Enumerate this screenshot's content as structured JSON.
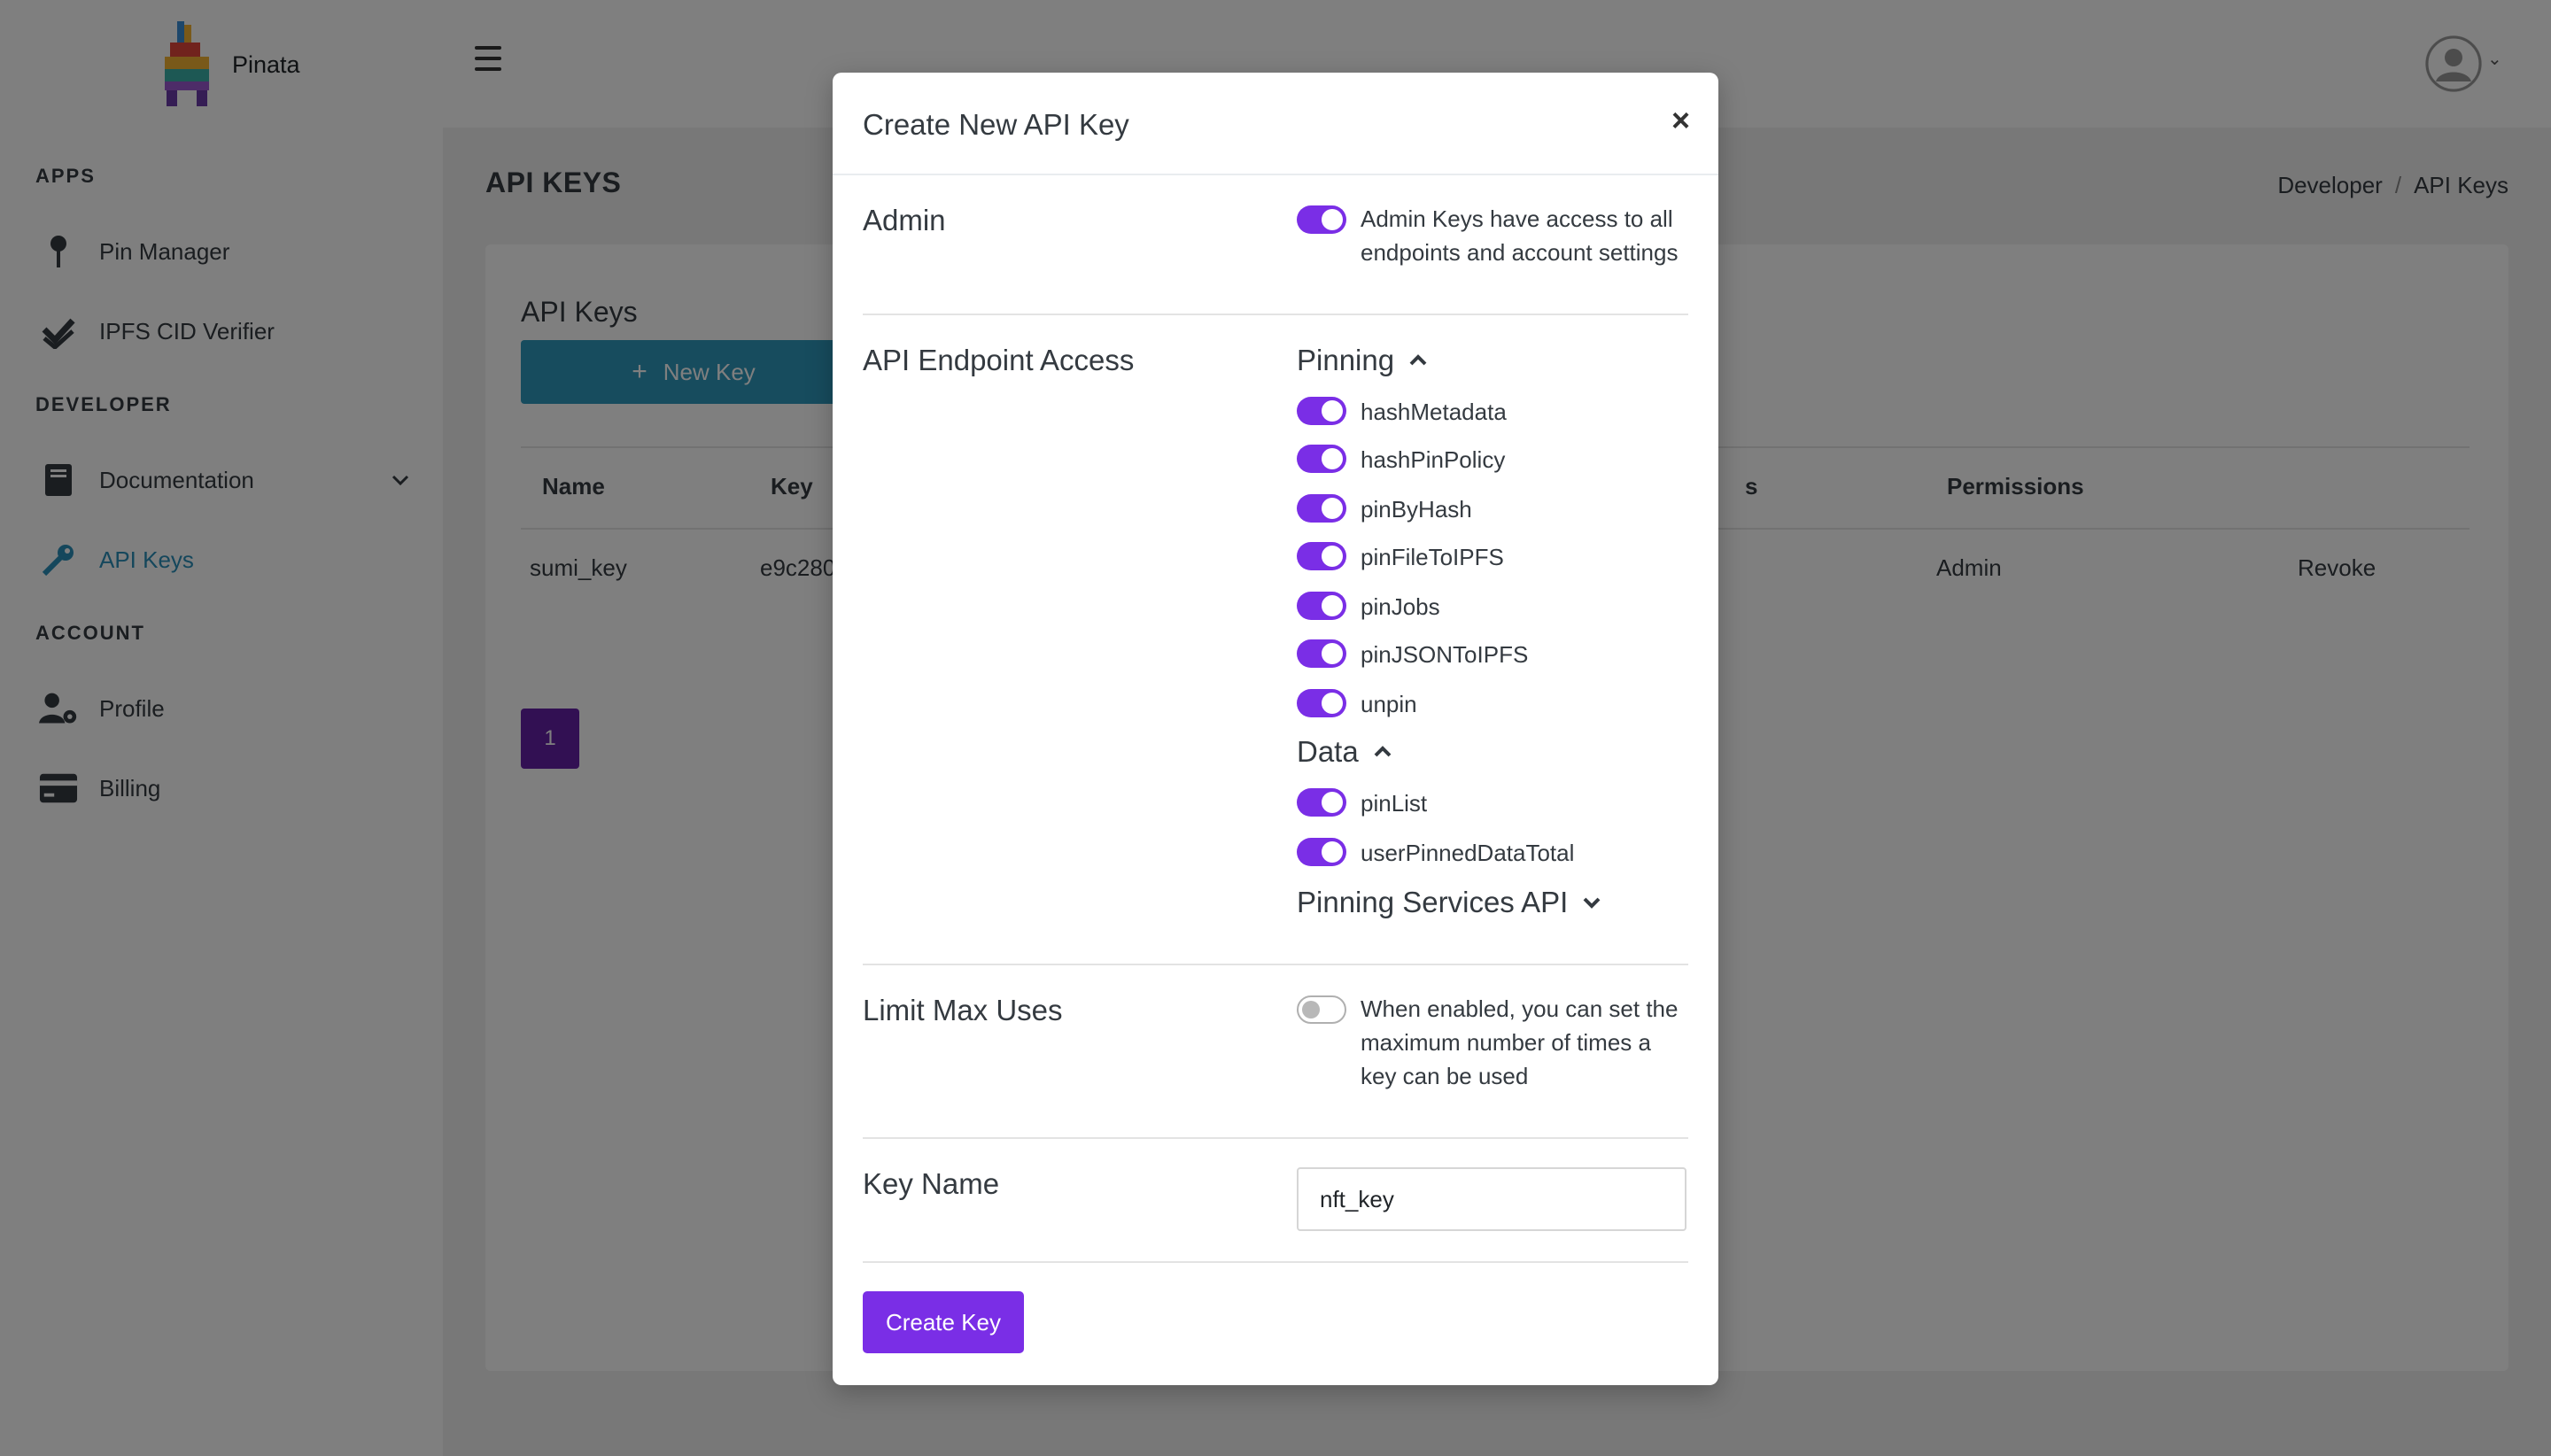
{
  "brand": {
    "name": "Pinata"
  },
  "sidebar": {
    "sections": [
      {
        "title": "APPS"
      },
      {
        "title": "DEVELOPER"
      },
      {
        "title": "ACCOUNT"
      }
    ],
    "items": [
      {
        "label": "Pin Manager",
        "icon": "pin-icon"
      },
      {
        "label": "IPFS CID Verifier",
        "icon": "checkmark-icon"
      },
      {
        "label": "Documentation",
        "icon": "book-icon"
      },
      {
        "label": "API Keys",
        "icon": "key-icon",
        "active": true
      },
      {
        "label": "Profile",
        "icon": "user-gear-icon"
      },
      {
        "label": "Billing",
        "icon": "credit-card-icon"
      }
    ]
  },
  "page": {
    "title": "API KEYS",
    "breadcrumb": [
      "Developer",
      "/",
      "API Keys"
    ]
  },
  "card": {
    "title": "API Keys",
    "new_key_label": "New Key",
    "columns": [
      "Name",
      "Key",
      "s",
      "Permissions"
    ],
    "row": {
      "name": "sumi_key",
      "key": "e9c280",
      "permissions": "Admin",
      "action": "Revoke"
    },
    "page_number": "1"
  },
  "modal": {
    "title": "Create New API Key",
    "close": "×",
    "admin": {
      "label": "Admin",
      "enabled": true,
      "description": "Admin Keys have access to all endpoints and account settings"
    },
    "endpoint_access": {
      "label": "API Endpoint Access",
      "groups": [
        {
          "name": "Pinning",
          "expanded": true,
          "items": [
            "hashMetadata",
            "hashPinPolicy",
            "pinByHash",
            "pinFileToIPFS",
            "pinJobs",
            "pinJSONToIPFS",
            "unpin"
          ]
        },
        {
          "name": "Data",
          "expanded": true,
          "items": [
            "pinList",
            "userPinnedDataTotal"
          ]
        },
        {
          "name": "Pinning Services API",
          "expanded": false,
          "items": []
        }
      ]
    },
    "limit": {
      "label": "Limit Max Uses",
      "enabled": false,
      "description": "When enabled, you can set the maximum number of times a key can be used"
    },
    "key_name": {
      "label": "Key Name",
      "value": "nft_key"
    },
    "submit_label": "Create Key"
  },
  "colors": {
    "accent": "#7a2ee6",
    "teal": "#2f98bd",
    "pager": "#6420a6"
  }
}
